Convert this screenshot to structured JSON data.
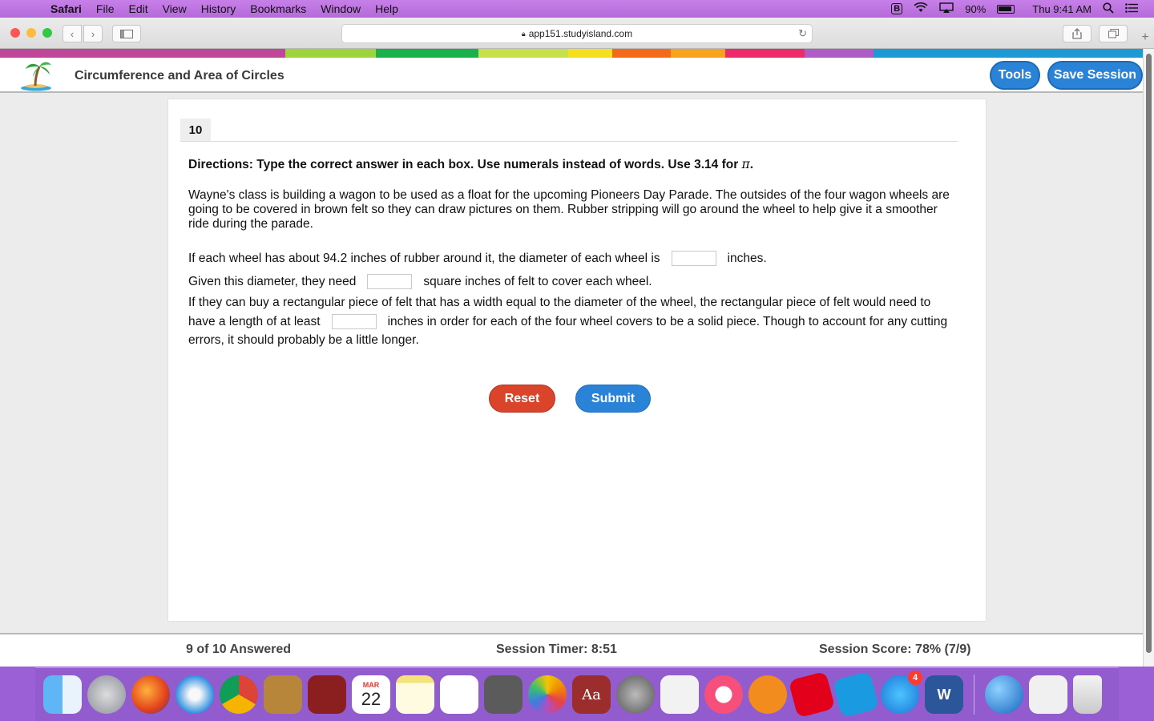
{
  "menubar": {
    "app": "Safari",
    "items": [
      "File",
      "Edit",
      "View",
      "History",
      "Bookmarks",
      "Window",
      "Help"
    ],
    "battery": "90%",
    "clock": "Thu 9:41 AM"
  },
  "browser": {
    "url": "app151.studyisland.com"
  },
  "stripe_colors": [
    "#c0469a",
    "#9dd43b",
    "#19b24a",
    "#c8e04a",
    "#f4e01c",
    "#f46a19",
    "#f8a31b",
    "#ef2a6a",
    "#b05cc6",
    "#1d9ad6"
  ],
  "header": {
    "title": "Circumference and Area of Circles",
    "tools_label": "Tools",
    "save_label": "Save Session"
  },
  "question": {
    "number": "10",
    "directions": "Directions: Type the correct answer in each box. Use numerals instead of words. Use 3.14 for",
    "pi_symbol": "π",
    "directions_end": ".",
    "paragraph": "Wayne's class is building a wagon to be used as a float for the upcoming Pioneers Day Parade.  The outsides of the four wagon wheels are going to be covered in brown felt so they can draw pictures on them.  Rubber stripping will go around the wheel to help give it a smoother ride during the parade.",
    "line1_before": "If each wheel has about 94.2 inches of rubber around it, the diameter of each wheel is",
    "line1_after": "inches.",
    "line2_before": "Given this diameter, they need",
    "line2_after": "square inches of felt to cover each wheel.",
    "line3_before": "If they can buy a rectangular piece of felt that has a width equal to the diameter of the wheel, the rectangular piece of felt would need to have a length of at least",
    "line3_after": "inches in order for each of the four wheel covers to be a solid piece. Though to account for any cutting errors, it should probably be a little longer.",
    "answers": [
      "",
      "",
      ""
    ]
  },
  "buttons": {
    "reset": "Reset",
    "submit": "Submit"
  },
  "footer": {
    "answered": "9 of 10 Answered",
    "timer": "Session Timer: 8:51",
    "score": "Session Score: 78% (7/9)"
  },
  "dock": {
    "calendar_month": "MAR",
    "calendar_day": "22",
    "appstore_badge": "4"
  }
}
